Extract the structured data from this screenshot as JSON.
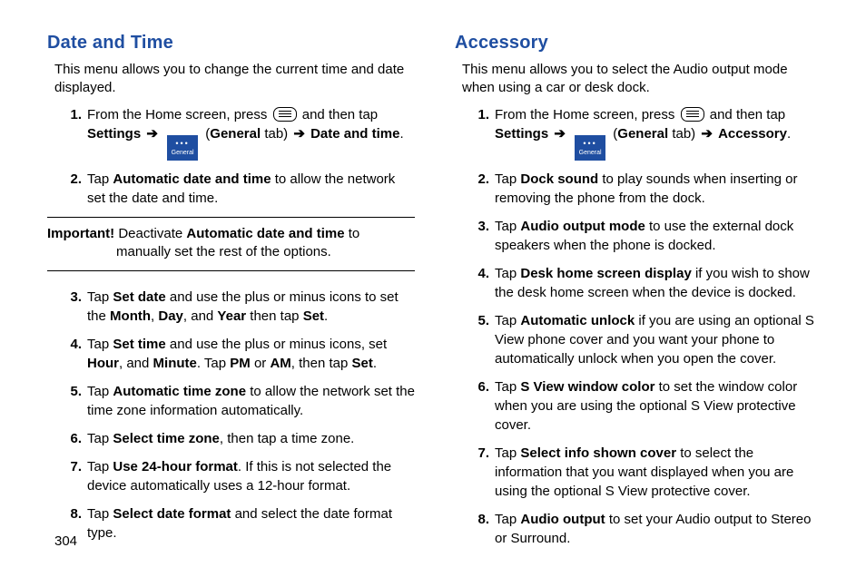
{
  "left": {
    "heading": "Date and Time",
    "intro": "This menu allows you to change the current time and date displayed.",
    "step1_a": "From the Home screen, press ",
    "step1_b": " and then tap ",
    "step1_settings": "Settings",
    "step1_general_tab": "General",
    "step1_tab_word": " tab) ",
    "step1_target": "Date and time",
    "step2_a": "Tap ",
    "step2_bold": "Automatic date and time",
    "step2_b": " to allow the network set the date and time.",
    "important_label": "Important! ",
    "important_a": "Deactivate ",
    "important_bold": "Automatic date and time",
    "important_b": " to manually set the rest of the options.",
    "step3_a": "Tap ",
    "step3_b1": "Set date",
    "step3_c": " and use the plus or minus icons to set the ",
    "step3_b2": "Month",
    "step3_d": ", ",
    "step3_b3": "Day",
    "step3_e": ", and ",
    "step3_b4": "Year",
    "step3_f": " then tap ",
    "step3_b5": "Set",
    "step4_a": "Tap ",
    "step4_b1": "Set time",
    "step4_c": " and use the plus or minus icons, set ",
    "step4_b2": "Hour",
    "step4_d": ", and ",
    "step4_b3": "Minute",
    "step4_e": ". Tap ",
    "step4_b4": "PM",
    "step4_f": " or ",
    "step4_b5": "AM",
    "step4_g": ", then tap ",
    "step4_b6": "Set",
    "step5_a": "Tap ",
    "step5_b": "Automatic time zone",
    "step5_c": " to allow the network set the time zone information automatically.",
    "step6_a": "Tap ",
    "step6_b": "Select time zone",
    "step6_c": ", then tap a time zone.",
    "step7_a": "Tap ",
    "step7_b": "Use 24-hour format",
    "step7_c": ". If this is not selected the device automatically uses a 12-hour format.",
    "step8_a": "Tap ",
    "step8_b": "Select date format",
    "step8_c": " and select the date format type."
  },
  "right": {
    "heading": "Accessory",
    "intro": "This menu allows you to select the Audio output mode when using a car or desk dock.",
    "step1_a": "From the Home screen, press ",
    "step1_b": " and then tap ",
    "step1_settings": "Settings",
    "step1_general_tab": "General",
    "step1_tab_word": " tab) ",
    "step1_target": "Accessory",
    "step2_a": "Tap ",
    "step2_b": "Dock sound",
    "step2_c": " to play sounds when inserting or removing the phone from the dock.",
    "step3_a": "Tap ",
    "step3_b": "Audio output mode",
    "step3_c": " to use the external dock speakers when the phone is docked.",
    "step4_a": "Tap ",
    "step4_b": "Desk home screen display",
    "step4_c": " if you wish to show the desk home screen when the device is docked.",
    "step5_a": "Tap ",
    "step5_b": "Automatic unlock",
    "step5_c": " if you are using an optional S View phone cover and you want your phone to automatically unlock when you open the cover.",
    "step6_a": "Tap ",
    "step6_b": "S View window color",
    "step6_c": " to set the window color when you are using the optional S View protective cover.",
    "step7_a": "Tap ",
    "step7_b": "Select info shown cover",
    "step7_c": " to select the information that you want displayed when you are using the optional S View protective cover.",
    "step8_a": "Tap ",
    "step8_b": "Audio output",
    "step8_c": " to set your Audio output to Stereo or Surround."
  },
  "icons": {
    "general_label": "General",
    "arrow": "➔"
  },
  "page_number": "304"
}
